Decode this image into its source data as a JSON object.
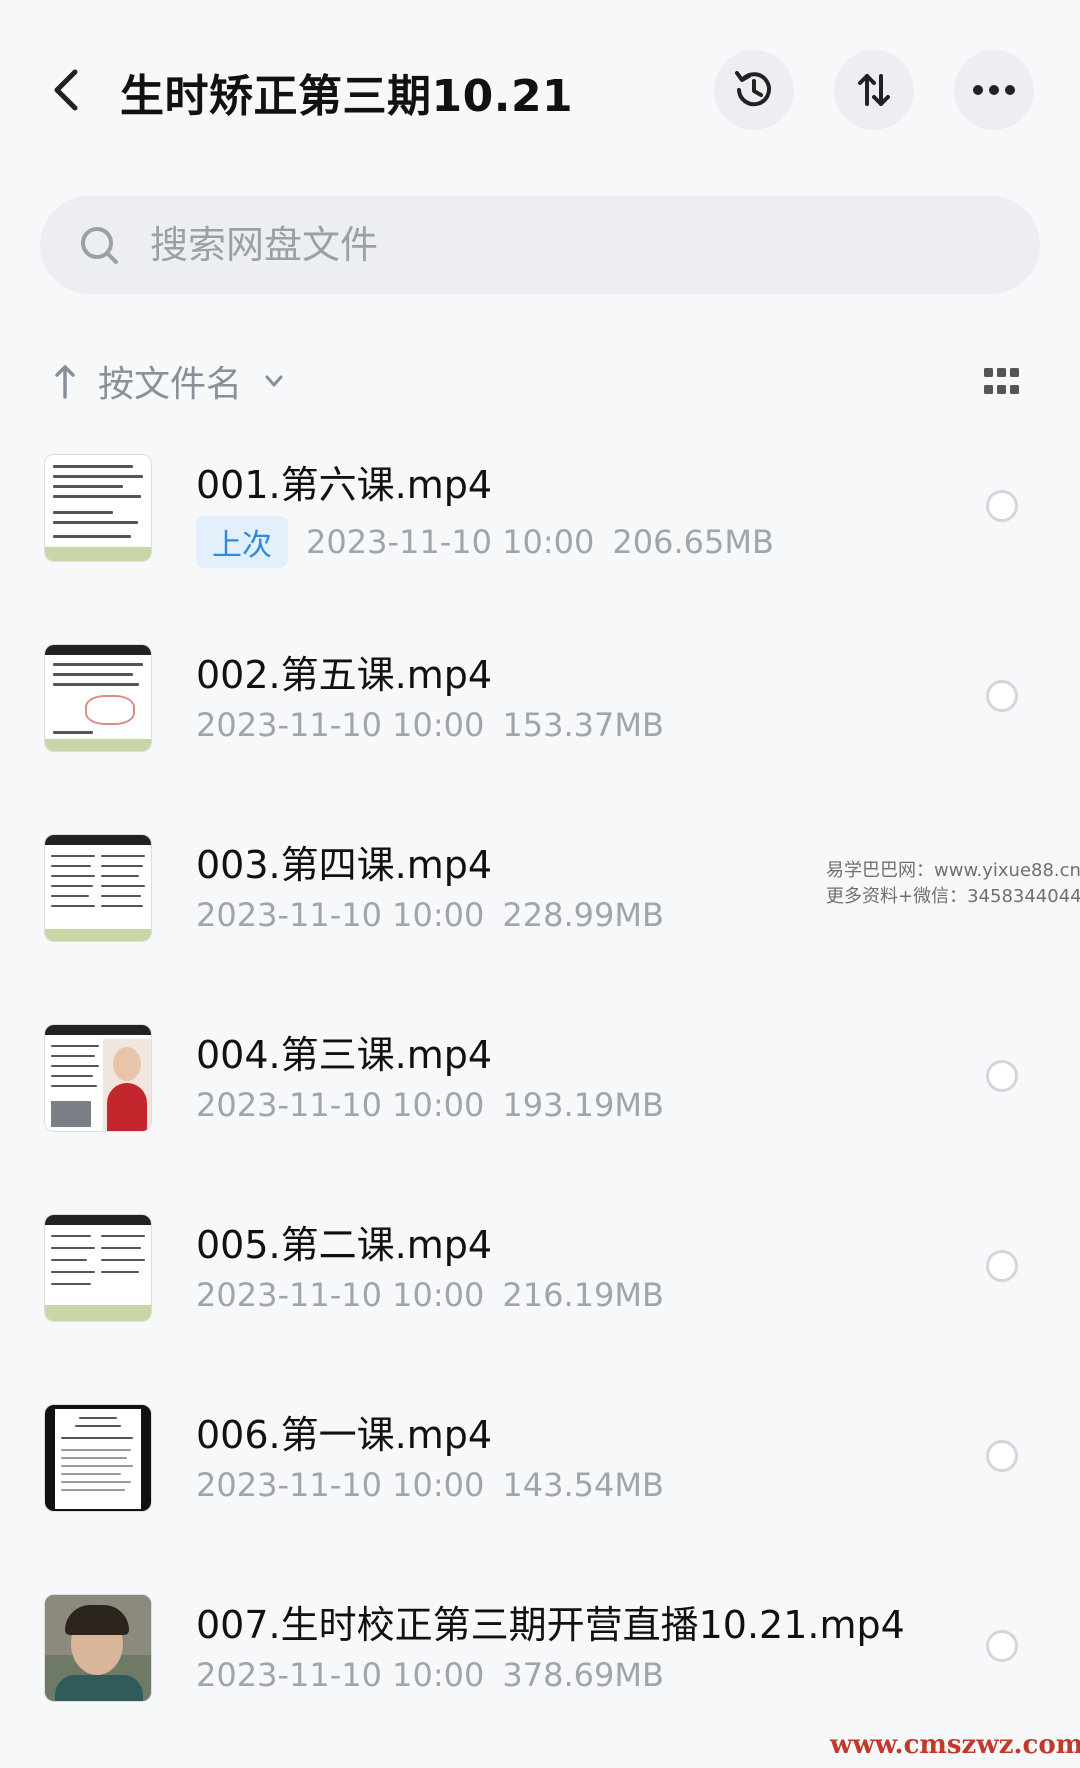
{
  "header": {
    "title": "生时矫正第三期10.21",
    "back_icon": "chevron-left-icon",
    "history_icon": "history-icon",
    "sort_icon": "sort-arrows-icon",
    "more_icon": "more-dots-icon"
  },
  "search": {
    "placeholder": "搜索网盘文件",
    "value": ""
  },
  "sortbar": {
    "label": "按文件名",
    "direction_icon": "arrow-up-icon",
    "dropdown_icon": "chevron-down-icon",
    "view_toggle_icon": "grid-view-icon"
  },
  "files": [
    {
      "name": "001.第六课.mp4",
      "badge": "上次",
      "date": "2023-11-10  10:00",
      "size": "206.65MB",
      "thumb": "doc"
    },
    {
      "name": "002.第五课.mp4",
      "badge": "",
      "date": "2023-11-10  10:00",
      "size": "153.37MB",
      "thumb": "doc"
    },
    {
      "name": "003.第四课.mp4",
      "badge": "",
      "date": "2023-11-10  10:00",
      "size": "228.99MB",
      "thumb": "doc"
    },
    {
      "name": "004.第三课.mp4",
      "badge": "",
      "date": "2023-11-10  10:00",
      "size": "193.19MB",
      "thumb": "person-doc"
    },
    {
      "name": "005.第二课.mp4",
      "badge": "",
      "date": "2023-11-10  10:00",
      "size": "216.19MB",
      "thumb": "doc"
    },
    {
      "name": "006.第一课.mp4",
      "badge": "",
      "date": "2023-11-10  10:00",
      "size": "143.54MB",
      "thumb": "dark-doc"
    },
    {
      "name": "007.生时校正第三期开营直播10.21.mp4",
      "badge": "",
      "date": "2023-11-10  10:00",
      "size": "378.69MB",
      "thumb": "video-person"
    }
  ],
  "watermark": {
    "line1": "易学巴巴网：www.yixue88.cn",
    "line2": "更多资料+微信：3458344044"
  },
  "footer_watermark": "www.cmszwz.com",
  "colors": {
    "badge_bg": "#e3f0fb",
    "badge_text": "#2a8ae0",
    "meta_text": "#a0a5ad"
  }
}
